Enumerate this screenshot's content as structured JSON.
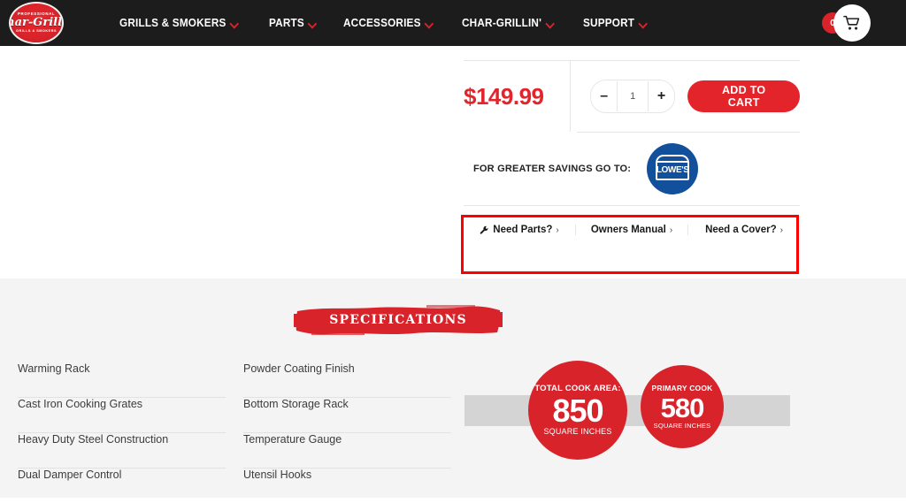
{
  "colors": {
    "brand_red": "#d8232a",
    "button_red": "#e3242b",
    "header_black": "#1c1c1c",
    "lowes_blue": "#13509c",
    "annotation_red": "#ff0000",
    "section_gray": "#f4f4f4",
    "bar_gray": "#d4d4d4"
  },
  "header": {
    "logo": {
      "icon": "char-griller-logo",
      "top_text": "PROFESSIONAL",
      "brand": "Char-Griller",
      "bottom_text": "GRILLS & SMOKERS"
    },
    "nav": [
      {
        "label": "GRILLS & SMOKERS",
        "icon": "chevron-down-icon"
      },
      {
        "label": "PARTS",
        "icon": "chevron-down-icon"
      },
      {
        "label": "ACCESSORIES",
        "icon": "chevron-down-icon"
      },
      {
        "label": "CHAR-GRILLIN'",
        "icon": "chevron-down-icon"
      },
      {
        "label": "SUPPORT",
        "icon": "chevron-down-icon"
      }
    ],
    "cart": {
      "count": "0",
      "icon": "shopping-cart-icon"
    }
  },
  "buybox": {
    "price": "$149.99",
    "quantity": {
      "decrement": "–",
      "value": "1",
      "increment": "+"
    },
    "add_to_cart": "ADD TO CART",
    "savings": {
      "label": "FOR GREATER SAVINGS GO TO:",
      "retailer": "LOWE'S",
      "retailer_icon": "lowes-logo"
    },
    "links": [
      {
        "label": "Need Parts?",
        "icon": "wrench-icon",
        "arrow": "›"
      },
      {
        "label": "Owners Manual",
        "icon": "",
        "arrow": "›"
      },
      {
        "label": "Need a Cover?",
        "icon": "",
        "arrow": "›"
      }
    ]
  },
  "specifications": {
    "banner_title": "SPECIFICATIONS",
    "column_left": [
      "Warming Rack",
      "Cast Iron Cooking Grates",
      "Heavy Duty Steel Construction",
      "Dual Damper Control"
    ],
    "column_right": [
      "Powder Coating Finish",
      "Bottom Storage Rack",
      "Temperature Gauge",
      "Utensil Hooks"
    ],
    "badges": [
      {
        "title": "TOTAL COOK AREA:",
        "value": "850",
        "unit": "SQUARE INCHES"
      },
      {
        "title": "PRIMARY COOK",
        "value": "580",
        "unit": "SQUARE INCHES"
      }
    ]
  }
}
